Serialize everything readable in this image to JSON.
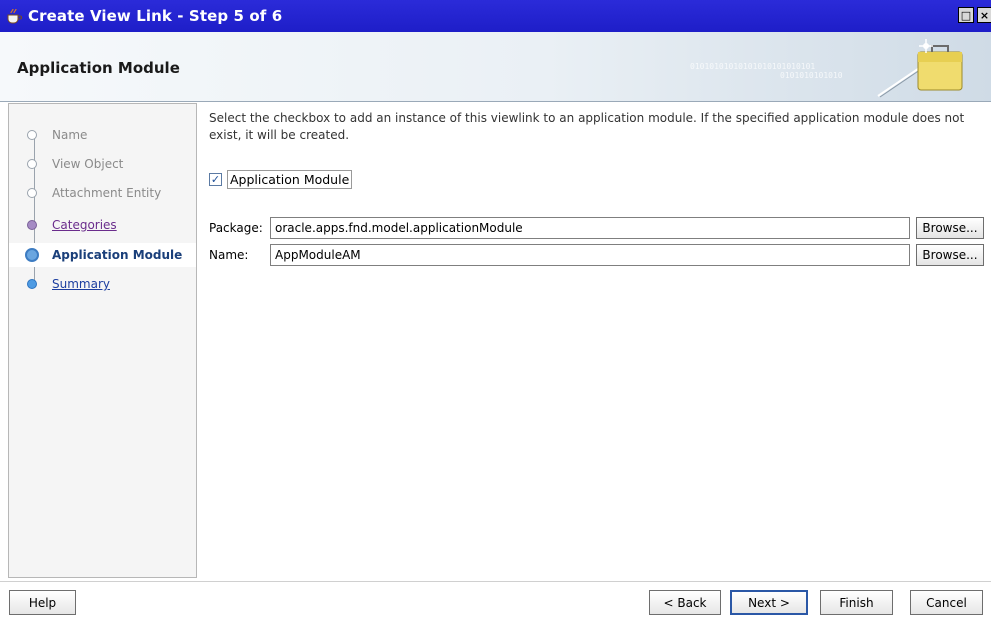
{
  "window": {
    "title": "Create View Link - Step 5 of 6",
    "icon": "coffee-cup-icon",
    "restore_glyph": "□",
    "close_glyph": "×"
  },
  "header": {
    "title": "Application Module",
    "binary_text_1": "01010101010101010101010101",
    "binary_text_2": "0101010101010",
    "art_icon": "briefcase-wand-icon"
  },
  "steps": [
    {
      "label": "Name",
      "state": "done"
    },
    {
      "label": "View Object",
      "state": "done"
    },
    {
      "label": "Attachment Entity",
      "state": "done"
    },
    {
      "label": "Categories",
      "state": "visited"
    },
    {
      "label": "Application Module",
      "state": "current"
    },
    {
      "label": "Summary",
      "state": "next"
    }
  ],
  "content": {
    "description": "Select the checkbox to add an instance of this viewlink to an application module. If the specified application module does not exist, it will be created.",
    "checkbox": {
      "label": "Application Module",
      "checked": true
    },
    "package": {
      "label": "Package:",
      "value": "oracle.apps.fnd.model.applicationModule",
      "browse_label": "Browse..."
    },
    "name": {
      "label": "Name:",
      "value": "AppModuleAM",
      "browse_label": "Browse..."
    }
  },
  "footer": {
    "help": "Help",
    "back": "< Back",
    "next": "Next >",
    "finish": "Finish",
    "cancel": "Cancel"
  },
  "colors": {
    "titlebar": "#1e1ec8",
    "current_step": "#1a3f7a",
    "visited_step": "#6a2c8c",
    "link": "#1c3ea0"
  }
}
